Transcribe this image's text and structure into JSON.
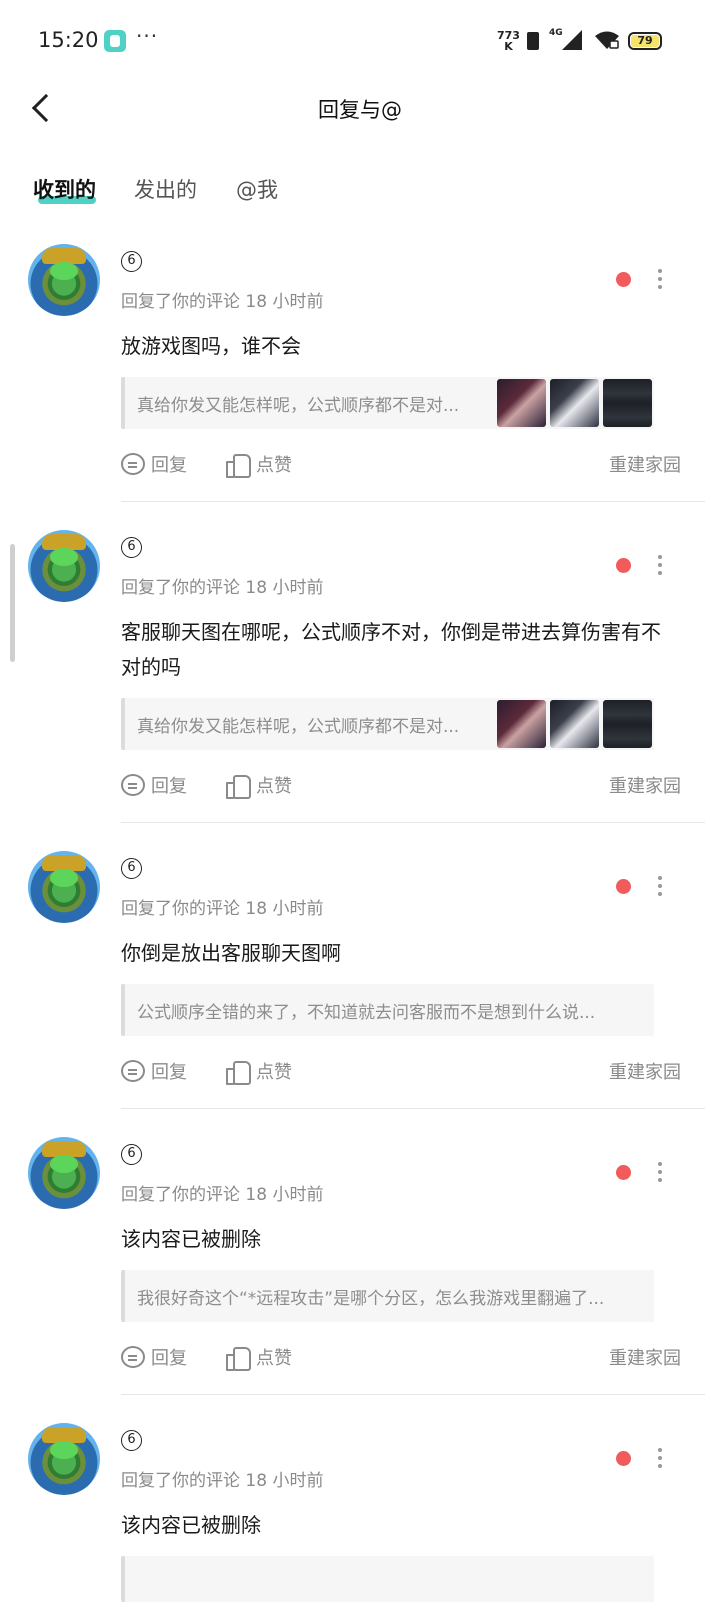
{
  "status": {
    "time": "15:20",
    "dots": "···",
    "net_speed_top": "773",
    "net_speed_bottom": "K",
    "net_type": "4G",
    "battery": "79"
  },
  "nav": {
    "title": "回复与@"
  },
  "tabs": [
    "收到的",
    "发出的",
    "@我"
  ],
  "items": [
    {
      "badge": "6",
      "meta": "回复了你的评论 18 小时前",
      "content": "放游戏图吗，谁不会",
      "quote": "真给你发又能怎样呢，公式顺序都不是对...",
      "reply": "回复",
      "like": "点赞",
      "source": "重建家园"
    },
    {
      "badge": "6",
      "meta": "回复了你的评论 18 小时前",
      "content": "客服聊天图在哪呢，公式顺序不对，你倒是带进去算伤害有不对的吗",
      "quote": "真给你发又能怎样呢，公式顺序都不是对...",
      "reply": "回复",
      "like": "点赞",
      "source": "重建家园"
    },
    {
      "badge": "6",
      "meta": "回复了你的评论 18 小时前",
      "content": "你倒是放出客服聊天图啊",
      "quote": "公式顺序全错的来了，不知道就去问客服而不是想到什么说...",
      "reply": "回复",
      "like": "点赞",
      "source": "重建家园"
    },
    {
      "badge": "6",
      "meta": "回复了你的评论 18 小时前",
      "content": "该内容已被删除",
      "quote": "我很好奇这个“*远程攻击”是哪个分区，怎么我游戏里翻遍了...",
      "reply": "回复",
      "like": "点赞",
      "source": "重建家园"
    },
    {
      "badge": "6",
      "meta": "回复了你的评论 18 小时前",
      "content": "该内容已被删除"
    }
  ]
}
